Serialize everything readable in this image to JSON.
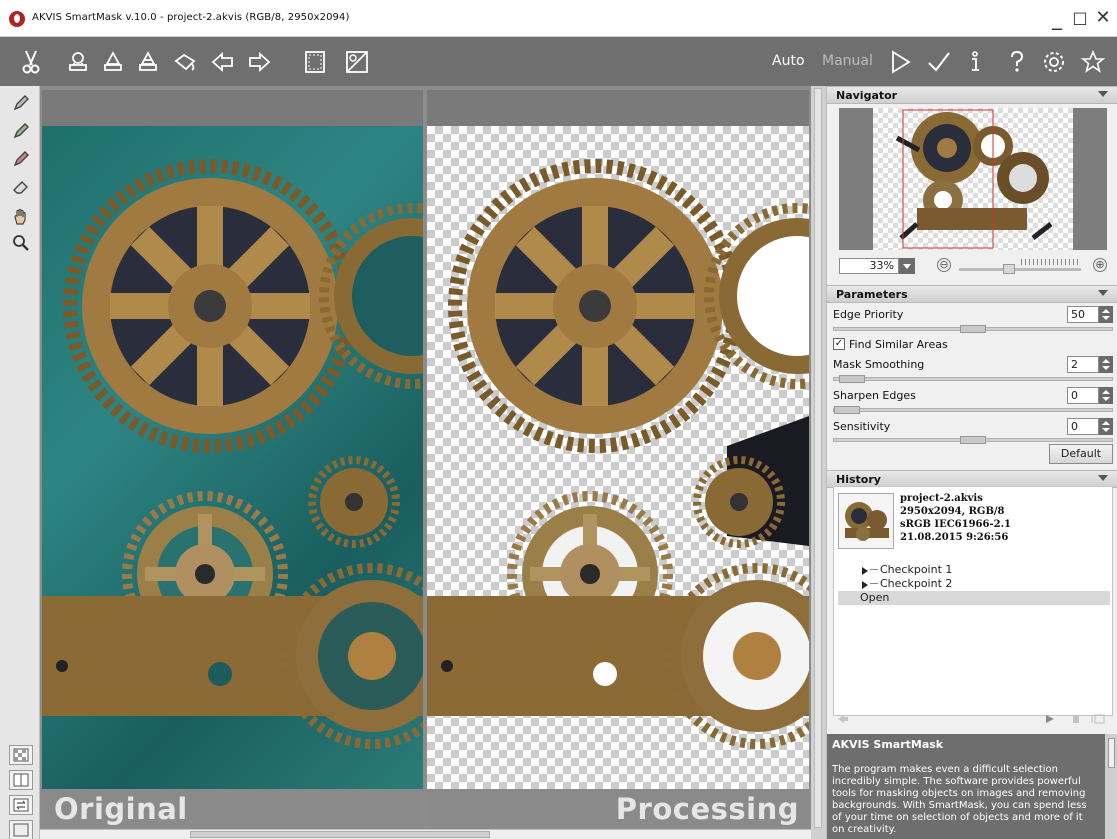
{
  "window": {
    "title": "AKVIS SmartMask v.10.0 - project-2.akvis (RGB/8, 2950x2094)",
    "controls": {
      "minimize": "_",
      "maximize": "□",
      "close": "✕"
    }
  },
  "toolbar": {
    "tools": [
      "scissors-icon",
      "stamp-icon",
      "magic-stamp-icon",
      "remove-stamp-icon",
      "paint-bucket-icon",
      "undo-arrow-icon",
      "redo-arrow-icon",
      "background-icon",
      "mask-view-icon"
    ],
    "mode_auto": "Auto",
    "mode_manual": "Manual",
    "right_icons": [
      "run-icon",
      "apply-icon",
      "info-icon",
      "help-icon",
      "settings-icon",
      "star-icon"
    ]
  },
  "left_tools": [
    "pencil-icon",
    "pencil-keep-icon",
    "pencil-remove-icon",
    "eraser-icon",
    "hand-icon",
    "zoom-icon"
  ],
  "canvas": {
    "left_label": "Original",
    "right_label": "Processing"
  },
  "navigator": {
    "title": "Navigator",
    "zoom": "33%",
    "minus": "⊖",
    "plus": "⊕"
  },
  "parameters": {
    "title": "Parameters",
    "edge_priority": {
      "label": "Edge Priority",
      "value": "50",
      "fraction": 0.5
    },
    "find_similar": {
      "label": "Find Similar Areas",
      "checked": true,
      "mark": "✓"
    },
    "mask_smoothing": {
      "label": "Mask Smoothing",
      "value": "2",
      "fraction": 0.02
    },
    "sharpen_edges": {
      "label": "Sharpen Edges",
      "value": "0",
      "fraction": 0
    },
    "sensitivity": {
      "label": "Sensitivity",
      "value": "0",
      "fraction": 0.5
    },
    "default_btn": "Default"
  },
  "history": {
    "title": "History",
    "file": "project-2.akvis",
    "dims": "2950x2094, RGB/8",
    "profile": "sRGB IEC61966-2.1",
    "date": "21.08.2015 9:26:56",
    "items": [
      "Checkpoint 1",
      "Checkpoint 2"
    ],
    "open": "Open"
  },
  "info": {
    "title": "AKVIS SmartMask",
    "text": "The program makes even a difficult selection incredibly simple. The software provides powerful tools for masking objects on images and removing backgrounds. With SmartMask, you can spend less of your time on selection of objects and more of it on creativity."
  },
  "colors": {
    "toolbar": "#6f6f6f",
    "accent": "#b22020"
  }
}
